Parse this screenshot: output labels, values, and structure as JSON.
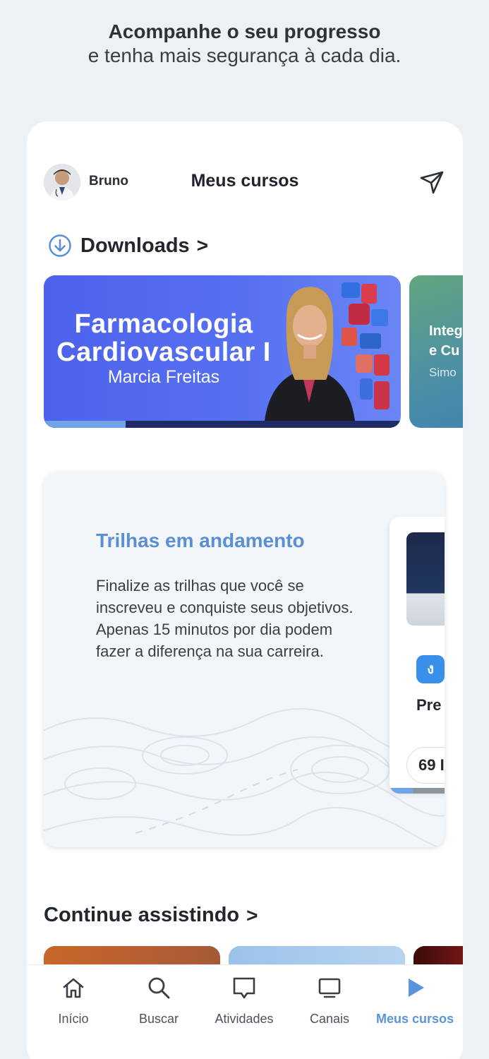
{
  "promo": {
    "line1": "Acompanhe o seu progresso",
    "line2": "e tenha mais segurança à cada dia."
  },
  "header": {
    "user_name": "Bruno",
    "title": "Meus cursos",
    "send_icon": "paper-plane-icon"
  },
  "downloads": {
    "label": "Downloads",
    "chevron": ">",
    "icon": "download-circle-icon"
  },
  "courses": [
    {
      "title_line1": "Farmacologia",
      "title_line2": "Cardiovascular I",
      "instructor": "Marcia Freitas",
      "progress": 0.23,
      "color": "#4d62ec"
    },
    {
      "title_line1": "Integ",
      "title_line2": "e Cu",
      "instructor": "Simo",
      "color": "#4d90a3"
    }
  ],
  "trails": {
    "title": "Trilhas em andamento",
    "description": "Finalize as trilhas que você se inscreveu e conquiste seus objetivos. Apenas 15 minutos por dia podem fazer a diferença na sua carreira.",
    "title_color": "#5b8fd3",
    "card": {
      "badge": "ง",
      "name": "Pre",
      "count": "69 I",
      "progress": 0.3
    }
  },
  "continue": {
    "label": "Continue assistindo",
    "chevron": ">"
  },
  "tabbar": {
    "active_color": "#5b93dc",
    "items": [
      {
        "label": "Início",
        "icon": "home-icon"
      },
      {
        "label": "Buscar",
        "icon": "search-icon"
      },
      {
        "label": "Atividades",
        "icon": "chat-bubble-icon"
      },
      {
        "label": "Canais",
        "icon": "tv-icon"
      },
      {
        "label": "Meus cursos",
        "icon": "play-icon",
        "active": true
      }
    ]
  }
}
